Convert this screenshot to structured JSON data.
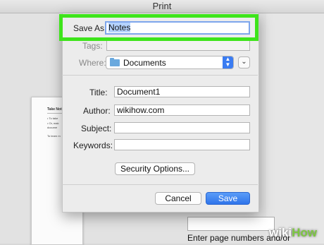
{
  "window": {
    "title": "Print"
  },
  "preview": {
    "title": "Take Not",
    "lines": [
      "• To take",
      "• Or, mak",
      "  docume",
      "To learn m"
    ]
  },
  "page_range": {
    "hint": "Enter page numbers and/or"
  },
  "dialog": {
    "save_as": {
      "label": "Save As:",
      "value": "Notes"
    },
    "tags": {
      "label": "Tags:",
      "value": ""
    },
    "where": {
      "label": "Where:",
      "value": "Documents"
    },
    "title": {
      "label": "Title:",
      "value": "Document1"
    },
    "author": {
      "label": "Author:",
      "value": "wikihow.com"
    },
    "subject": {
      "label": "Subject:",
      "value": ""
    },
    "keywords": {
      "label": "Keywords:",
      "value": ""
    },
    "security_button": "Security Options...",
    "cancel_button": "Cancel",
    "save_button": "Save"
  },
  "watermark": {
    "wiki": "wiki",
    "how": "How"
  },
  "colors": {
    "highlight": "#3ee41b",
    "primary": "#2f74ea",
    "folder": "#6aa9de"
  },
  "icons": {
    "folder": "folder-icon",
    "updown": "updown-arrows-icon",
    "expand": "chevron-down-icon"
  }
}
